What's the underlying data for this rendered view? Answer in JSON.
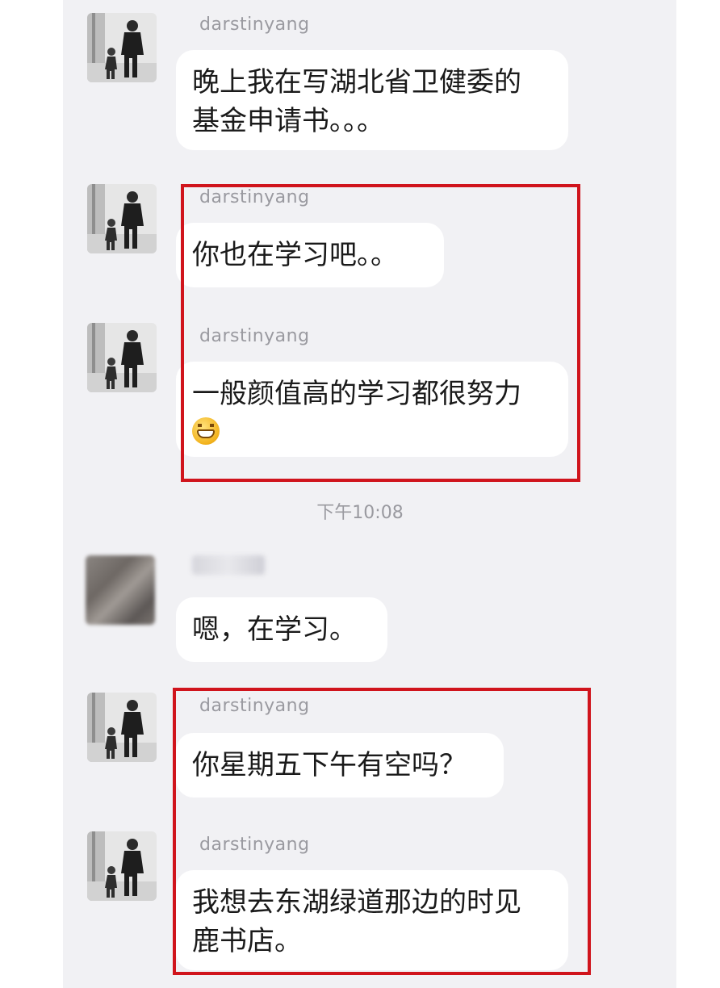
{
  "chat": {
    "messages": [
      {
        "sender": "darstinyang",
        "lines": [
          "晚上我在写湖北省卫健委的",
          "基金申请书。。。"
        ]
      },
      {
        "sender": "darstinyang",
        "lines": [
          "你也在学习吧。。"
        ]
      },
      {
        "sender": "darstinyang",
        "lines": [
          "一般颜值高的学习都很努力"
        ],
        "emoji": "grinning-face-icon"
      },
      {
        "sender": "",
        "lines": [
          "嗯，在学习。"
        ]
      },
      {
        "sender": "darstinyang",
        "lines": [
          "你星期五下午有空吗？"
        ]
      },
      {
        "sender": "darstinyang",
        "lines": [
          "我想去东湖绿道那边的时见",
          "鹿书店。"
        ]
      }
    ],
    "timestamp": "下午10:08"
  },
  "colors": {
    "highlight_border": "#d0141c",
    "chat_background": "#f1f1f4",
    "bubble_background": "#ffffff"
  }
}
